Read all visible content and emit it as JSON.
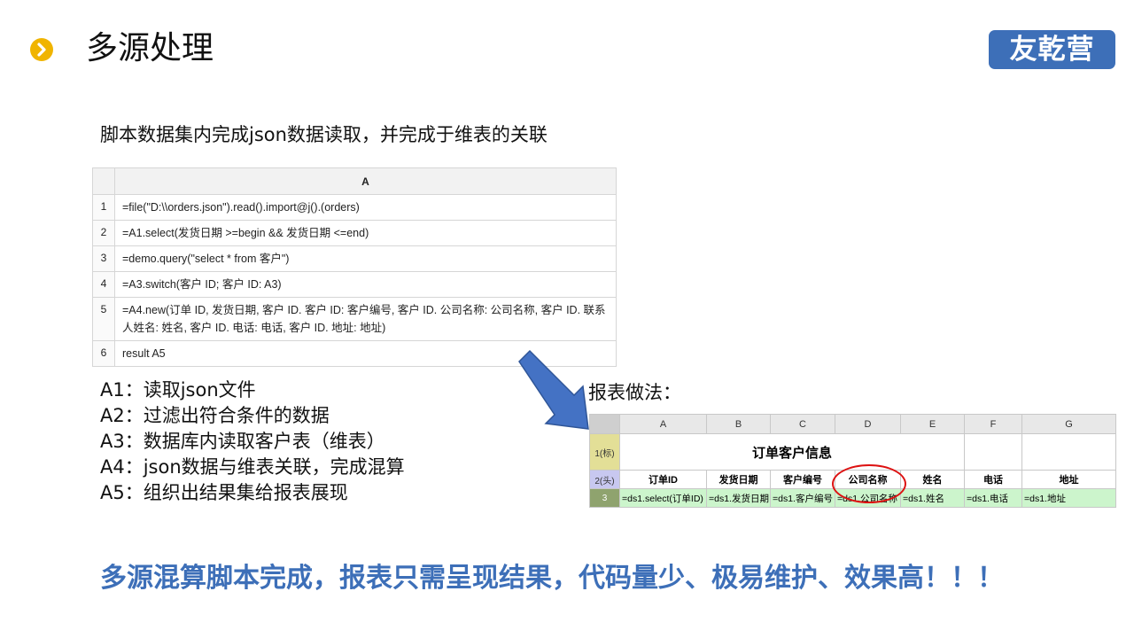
{
  "slide": {
    "title": "多源处理",
    "logo_text": "友乾营",
    "subtitle": "脚本数据集内完成json数据读取，并完成于维表的关联",
    "report_label": "报表做法：",
    "footer": "多源混算脚本完成，报表只需呈现结果，代码量少、极易维护、效果高！！！",
    "colors": {
      "accent_blue": "#3d6fb8",
      "bullet_yellow": "#f0b400",
      "circle_red": "#dd1111"
    }
  },
  "script": {
    "column_header": "A",
    "rows": [
      {
        "num": "1",
        "code": "=file(\"D:\\\\orders.json\").read().import@j().(orders)"
      },
      {
        "num": "2",
        "code": "=A1.select(发货日期 >=begin && 发货日期 <=end)"
      },
      {
        "num": "3",
        "code": "=demo.query(\"select * from 客户\")"
      },
      {
        "num": "4",
        "code": "=A3.switch(客户 ID; 客户 ID:  A3)"
      },
      {
        "num": "5",
        "code": "=A4.new(订单 ID, 发货日期, 客户 ID. 客户 ID: 客户编号, 客户 ID. 公司名称: 公司名称, 客户 ID. 联系人姓名: 姓名, 客户 ID. 电话: 电话, 客户 ID. 地址: 地址)"
      },
      {
        "num": "6",
        "code": "result A5"
      }
    ]
  },
  "notes": [
    "A1：读取json文件",
    "A2：过滤出符合条件的数据",
    "A3：数据库内读取客户表（维表）",
    "A4：json数据与维表关联，完成混算",
    "A5：组织出结果集给报表展现"
  ],
  "report": {
    "columns": [
      "A",
      "B",
      "C",
      "D",
      "E",
      "F",
      "G"
    ],
    "row_labels": [
      "1(标)",
      "2(头)",
      "3"
    ],
    "title": "订单客户信息",
    "headers": [
      "订单ID",
      "发货日期",
      "客户编号",
      "公司名称",
      "姓名",
      "电话",
      "地址"
    ],
    "details": [
      "=ds1.select(订单ID)",
      "=ds1.发货日期",
      "=ds1.客户编号",
      "=ds1.公司名称",
      "=ds1.姓名",
      "=ds1.电话",
      "=ds1.地址"
    ]
  }
}
